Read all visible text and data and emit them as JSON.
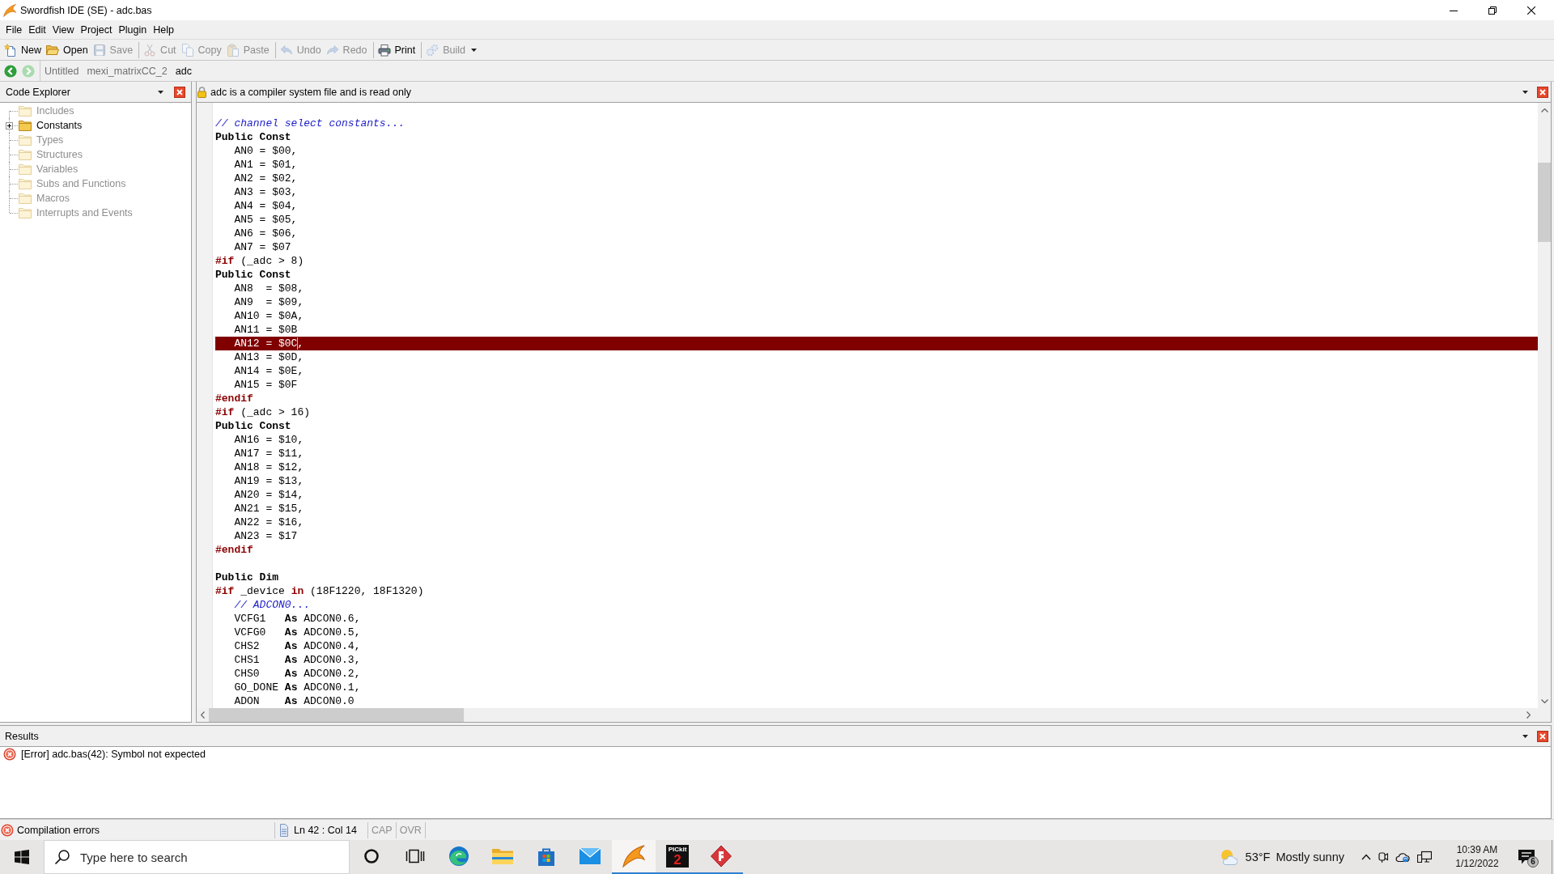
{
  "window": {
    "title": "Swordfish IDE (SE) - adc.bas"
  },
  "menu": [
    "File",
    "Edit",
    "View",
    "Project",
    "Plugin",
    "Help"
  ],
  "toolbar": {
    "groups": [
      {
        "buttons": [
          {
            "label": "New",
            "disabled": false,
            "kind": "plain"
          },
          {
            "label": "Open",
            "disabled": false,
            "kind": "plain"
          },
          {
            "label": "Save",
            "disabled": true,
            "kind": "plain"
          }
        ]
      },
      {
        "buttons": [
          {
            "label": "Cut",
            "disabled": true,
            "kind": "plain"
          },
          {
            "label": "Copy",
            "disabled": true,
            "kind": "plain"
          },
          {
            "label": "Paste",
            "disabled": true,
            "kind": "plain"
          }
        ]
      },
      {
        "buttons": [
          {
            "label": "Undo",
            "disabled": true,
            "kind": "plain"
          },
          {
            "label": "Redo",
            "disabled": true,
            "kind": "plain"
          }
        ]
      },
      {
        "buttons": [
          {
            "label": "Print",
            "disabled": false,
            "kind": "plain"
          }
        ]
      },
      {
        "buttons": [
          {
            "label": "Build",
            "disabled": true,
            "kind": "menu"
          }
        ]
      }
    ]
  },
  "navigation": {
    "buttons": [
      {
        "disabled": false
      },
      {
        "disabled": true
      }
    ],
    "tabs": [
      {
        "label": "Untitled",
        "selected": false
      },
      {
        "label": "mexi_matrixCC_2",
        "selected": false
      },
      {
        "label": "adc",
        "selected": true
      }
    ]
  },
  "code_explorer": {
    "title": "Code Explorer",
    "items": [
      {
        "label": "Includes",
        "disabled": true,
        "expandable": false,
        "expanded": false
      },
      {
        "label": "Constants",
        "disabled": false,
        "expandable": true,
        "expanded": false
      },
      {
        "label": "Types",
        "disabled": true,
        "expandable": false,
        "expanded": false
      },
      {
        "label": "Structures",
        "disabled": true,
        "expandable": false,
        "expanded": false
      },
      {
        "label": "Variables",
        "disabled": true,
        "expandable": false,
        "expanded": false
      },
      {
        "label": "Subs and Functions",
        "disabled": true,
        "expandable": false,
        "expanded": false
      },
      {
        "label": "Macros",
        "disabled": true,
        "expandable": false,
        "expanded": false
      },
      {
        "label": "Interrupts and Events",
        "disabled": true,
        "expandable": false,
        "expanded": false
      }
    ]
  },
  "editor": {
    "notice": "adc is a compiler system file and is read only",
    "lines": [
      {
        "highlighted": false
      },
      {
        "highlighted": false,
        "segments": [
          {
            "kind": "comment",
            "text": "// channel select constants..."
          }
        ]
      },
      {
        "highlighted": false,
        "segments": [
          {
            "kind": "keyword",
            "text": "Public Const"
          }
        ]
      },
      {
        "highlighted": false,
        "segments": [
          {
            "kind": "plain",
            "text": "   AN0 = $00,"
          }
        ]
      },
      {
        "highlighted": false,
        "segments": [
          {
            "kind": "plain",
            "text": "   AN1 = $01,"
          }
        ]
      },
      {
        "highlighted": false,
        "segments": [
          {
            "kind": "plain",
            "text": "   AN2 = $02,"
          }
        ]
      },
      {
        "highlighted": false,
        "segments": [
          {
            "kind": "plain",
            "text": "   AN3 = $03,"
          }
        ]
      },
      {
        "highlighted": false,
        "segments": [
          {
            "kind": "plain",
            "text": "   AN4 = $04,"
          }
        ]
      },
      {
        "highlighted": false,
        "segments": [
          {
            "kind": "plain",
            "text": "   AN5 = $05,"
          }
        ]
      },
      {
        "highlighted": false,
        "segments": [
          {
            "kind": "plain",
            "text": "   AN6 = $06,"
          }
        ]
      },
      {
        "highlighted": false,
        "segments": [
          {
            "kind": "plain",
            "text": "   AN7 = $07"
          }
        ]
      },
      {
        "highlighted": false,
        "segments": [
          {
            "kind": "directive",
            "text": "#if"
          },
          {
            "kind": "plain",
            "text": " (_adc > 8)"
          }
        ]
      },
      {
        "highlighted": false,
        "segments": [
          {
            "kind": "keyword",
            "text": "Public Const"
          }
        ]
      },
      {
        "highlighted": false,
        "segments": [
          {
            "kind": "plain",
            "text": "   AN8  = $08,"
          }
        ]
      },
      {
        "highlighted": false,
        "segments": [
          {
            "kind": "plain",
            "text": "   AN9  = $09,"
          }
        ]
      },
      {
        "highlighted": false,
        "segments": [
          {
            "kind": "plain",
            "text": "   AN10 = $0A,"
          }
        ]
      },
      {
        "highlighted": false,
        "segments": [
          {
            "kind": "plain",
            "text": "   AN11 = $0B"
          }
        ]
      },
      {
        "highlighted": true,
        "segments": [
          {
            "kind": "plain",
            "text": "   AN12 = $0C"
          },
          {
            "kind": "caret"
          },
          {
            "kind": "plain",
            "text": ","
          }
        ]
      },
      {
        "highlighted": false,
        "segments": [
          {
            "kind": "plain",
            "text": "   AN13 = $0D,"
          }
        ]
      },
      {
        "highlighted": false,
        "segments": [
          {
            "kind": "plain",
            "text": "   AN14 = $0E,"
          }
        ]
      },
      {
        "highlighted": false,
        "segments": [
          {
            "kind": "plain",
            "text": "   AN15 = $0F"
          }
        ]
      },
      {
        "highlighted": false,
        "segments": [
          {
            "kind": "directive",
            "text": "#endif"
          }
        ]
      },
      {
        "highlighted": false,
        "segments": [
          {
            "kind": "directive",
            "text": "#if"
          },
          {
            "kind": "plain",
            "text": " (_adc > 16)"
          }
        ]
      },
      {
        "highlighted": false,
        "segments": [
          {
            "kind": "keyword",
            "text": "Public Const"
          }
        ]
      },
      {
        "highlighted": false,
        "segments": [
          {
            "kind": "plain",
            "text": "   AN16 = $10,"
          }
        ]
      },
      {
        "highlighted": false,
        "segments": [
          {
            "kind": "plain",
            "text": "   AN17 = $11,"
          }
        ]
      },
      {
        "highlighted": false,
        "segments": [
          {
            "kind": "plain",
            "text": "   AN18 = $12,"
          }
        ]
      },
      {
        "highlighted": false,
        "segments": [
          {
            "kind": "plain",
            "text": "   AN19 = $13,"
          }
        ]
      },
      {
        "highlighted": false,
        "segments": [
          {
            "kind": "plain",
            "text": "   AN20 = $14,"
          }
        ]
      },
      {
        "highlighted": false,
        "segments": [
          {
            "kind": "plain",
            "text": "   AN21 = $15,"
          }
        ]
      },
      {
        "highlighted": false,
        "segments": [
          {
            "kind": "plain",
            "text": "   AN22 = $16,"
          }
        ]
      },
      {
        "highlighted": false,
        "segments": [
          {
            "kind": "plain",
            "text": "   AN23 = $17"
          }
        ]
      },
      {
        "highlighted": false,
        "segments": [
          {
            "kind": "directive",
            "text": "#endif"
          }
        ]
      },
      {
        "highlighted": false
      },
      {
        "highlighted": false,
        "segments": [
          {
            "kind": "keyword",
            "text": "Public Dim"
          }
        ]
      },
      {
        "highlighted": false,
        "segments": [
          {
            "kind": "directive",
            "text": "#if"
          },
          {
            "kind": "plain",
            "text": " _device "
          },
          {
            "kind": "directive",
            "text": "in"
          },
          {
            "kind": "plain",
            "text": " (18F1220, 18F1320)"
          }
        ]
      },
      {
        "highlighted": false,
        "segments": [
          {
            "kind": "comment",
            "text": "   // ADCON0..."
          }
        ]
      },
      {
        "highlighted": false,
        "segments": [
          {
            "kind": "plain",
            "text": "   VCFG1   "
          },
          {
            "kind": "keyword",
            "text": "As"
          },
          {
            "kind": "plain",
            "text": " ADCON0.6,"
          }
        ]
      },
      {
        "highlighted": false,
        "segments": [
          {
            "kind": "plain",
            "text": "   VCFG0   "
          },
          {
            "kind": "keyword",
            "text": "As"
          },
          {
            "kind": "plain",
            "text": " ADCON0.5,"
          }
        ]
      },
      {
        "highlighted": false,
        "segments": [
          {
            "kind": "plain",
            "text": "   CHS2    "
          },
          {
            "kind": "keyword",
            "text": "As"
          },
          {
            "kind": "plain",
            "text": " ADCON0.4,"
          }
        ]
      },
      {
        "highlighted": false,
        "segments": [
          {
            "kind": "plain",
            "text": "   CHS1    "
          },
          {
            "kind": "keyword",
            "text": "As"
          },
          {
            "kind": "plain",
            "text": " ADCON0.3,"
          }
        ]
      },
      {
        "highlighted": false,
        "segments": [
          {
            "kind": "plain",
            "text": "   CHS0    "
          },
          {
            "kind": "keyword",
            "text": "As"
          },
          {
            "kind": "plain",
            "text": " ADCON0.2,"
          }
        ]
      },
      {
        "highlighted": false,
        "segments": [
          {
            "kind": "plain",
            "text": "   GO_DONE "
          },
          {
            "kind": "keyword",
            "text": "As"
          },
          {
            "kind": "plain",
            "text": " ADCON0.1,"
          }
        ]
      },
      {
        "highlighted": false,
        "segments": [
          {
            "kind": "plain",
            "text": "   ADON    "
          },
          {
            "kind": "keyword",
            "text": "As"
          },
          {
            "kind": "plain",
            "text": " ADCON0.0"
          }
        ]
      }
    ]
  },
  "results": {
    "title": "Results",
    "messages": [
      {
        "kind": "error",
        "text": "[Error] adc.bas(42): Symbol not expected"
      }
    ]
  },
  "status_bar": {
    "message": {
      "kind": "error",
      "text": "Compilation errors"
    },
    "position": "Ln 42 : Col 14",
    "indicators": [
      {
        "label": "CAP",
        "on": false
      },
      {
        "label": "OVR",
        "on": false
      }
    ]
  },
  "taskbar": {
    "search": {
      "placeholder": "Type here to search"
    },
    "buttons": [
      {
        "running": false,
        "selected": false
      },
      {
        "running": false,
        "selected": false
      },
      {
        "running": false,
        "selected": false
      },
      {
        "running": false,
        "selected": false
      },
      {
        "running": false,
        "selected": false
      },
      {
        "running": false,
        "selected": false
      },
      {
        "running": true,
        "selected": true
      },
      {
        "running": true,
        "selected": false,
        "logo_text": "PICkit",
        "logo_number": "2"
      },
      {
        "running": true,
        "selected": false
      }
    ],
    "weather": {
      "temperature": "53°F",
      "condition": "Mostly sunny"
    },
    "clock": {
      "time": "10:39 AM",
      "date": "1/12/2022"
    },
    "notification_count": "6"
  }
}
